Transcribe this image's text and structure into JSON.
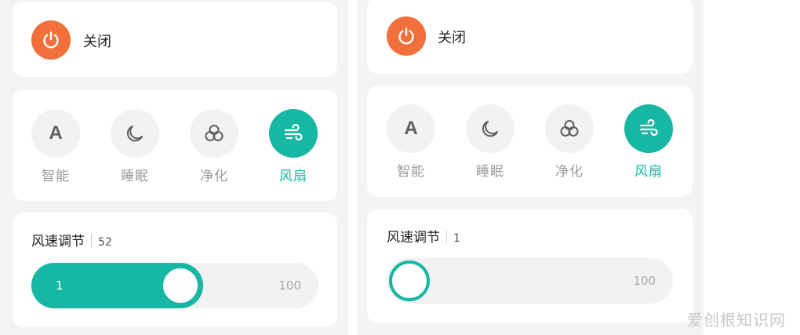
{
  "panels": [
    {
      "power": {
        "label": "关闭",
        "icon": "power-icon"
      },
      "modes": [
        {
          "label": "智能",
          "icon": "letter-a-icon",
          "glyph": "A",
          "active": false
        },
        {
          "label": "睡眠",
          "icon": "moon-icon",
          "active": false
        },
        {
          "label": "净化",
          "icon": "purify-icon",
          "active": false
        },
        {
          "label": "风扇",
          "icon": "wind-icon",
          "active": true
        }
      ],
      "speed": {
        "title": "风速调节",
        "value": "52",
        "min": "1",
        "max": "100",
        "level": 52
      }
    },
    {
      "power": {
        "label": "关闭",
        "icon": "power-icon"
      },
      "modes": [
        {
          "label": "智能",
          "icon": "letter-a-icon",
          "glyph": "A",
          "active": false
        },
        {
          "label": "睡眠",
          "icon": "moon-icon",
          "active": false
        },
        {
          "label": "净化",
          "icon": "purify-icon",
          "active": false
        },
        {
          "label": "风扇",
          "icon": "wind-icon",
          "active": true
        }
      ],
      "speed": {
        "title": "风速调节",
        "value": "1",
        "min": "1",
        "max": "100",
        "level": 1
      }
    }
  ],
  "watermark": "爱创根知识网",
  "colors": {
    "accent": "#16b7a3",
    "power": "#f2703b",
    "background": "#f4f4f4",
    "card": "#ffffff"
  }
}
